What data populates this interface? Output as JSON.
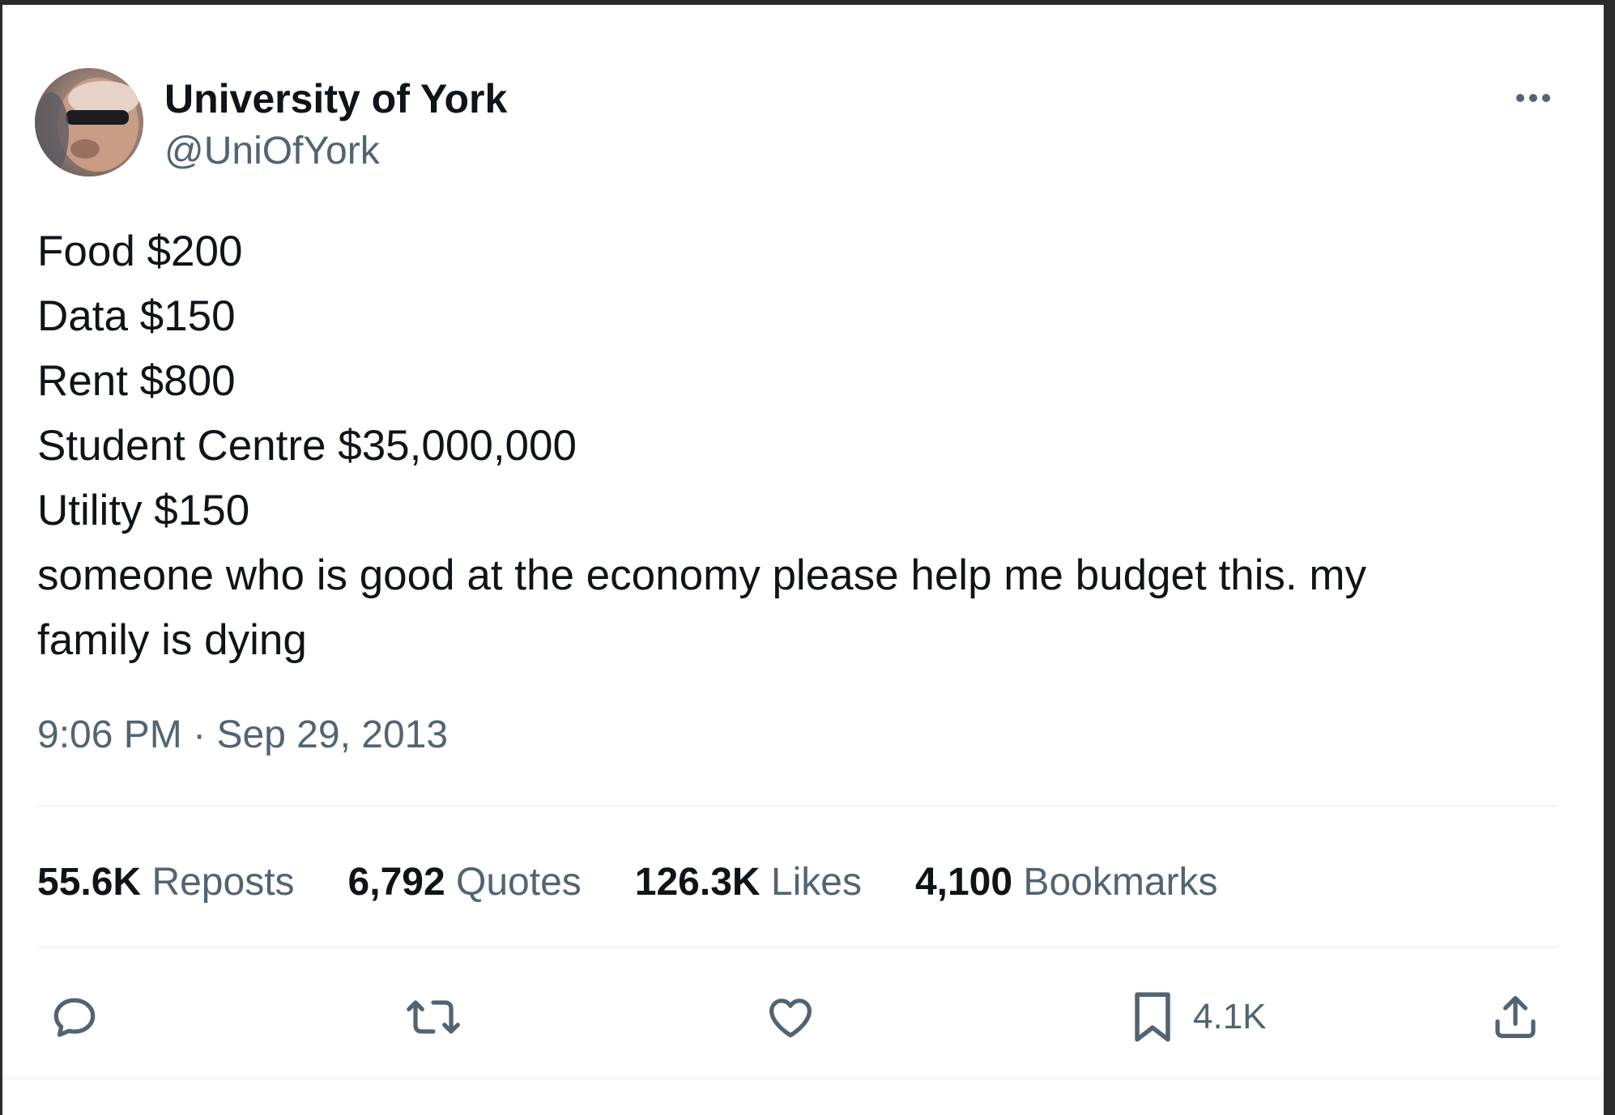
{
  "author": {
    "name": "University of York",
    "handle": "@UniOfYork"
  },
  "tweet": {
    "lines": [
      "Food $200",
      "Data $150",
      "Rent $800",
      "Student Centre $35,000,000",
      "Utility $150",
      "someone who is good at the economy please help me budget this. my",
      "family is dying"
    ],
    "time": "9:06 PM",
    "separator": "·",
    "date": "Sep 29, 2013"
  },
  "stats": {
    "reposts": {
      "value": "55.6K",
      "label": "Reposts"
    },
    "quotes": {
      "value": "6,792",
      "label": "Quotes"
    },
    "likes": {
      "value": "126.3K",
      "label": "Likes"
    },
    "bookmarks": {
      "value": "4,100",
      "label": "Bookmarks"
    }
  },
  "actions": {
    "reply_icon": "speech-bubble-icon",
    "repost_icon": "repost-arrows-icon",
    "like_icon": "heart-icon",
    "bookmark_icon": "bookmark-icon",
    "bookmark_count": "4.1K",
    "share_icon": "share-upload-icon"
  },
  "colors": {
    "text_primary": "#0f1419",
    "text_secondary": "#536471",
    "divider": "#eff3f4"
  }
}
